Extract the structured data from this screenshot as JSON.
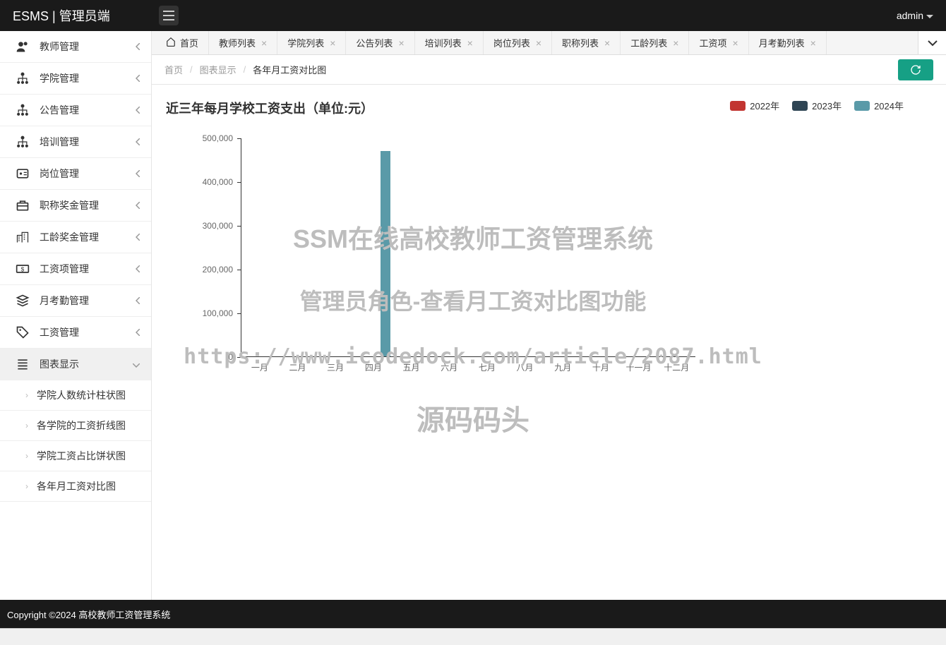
{
  "header": {
    "brand": "ESMS | 管理员端",
    "user": "admin"
  },
  "sidebar": {
    "items": [
      {
        "label": "教师管理",
        "icon": "users"
      },
      {
        "label": "学院管理",
        "icon": "org"
      },
      {
        "label": "公告管理",
        "icon": "org"
      },
      {
        "label": "培训管理",
        "icon": "org"
      },
      {
        "label": "岗位管理",
        "icon": "badge"
      },
      {
        "label": "职称奖金管理",
        "icon": "briefcase"
      },
      {
        "label": "工龄奖金管理",
        "icon": "building"
      },
      {
        "label": "工资项管理",
        "icon": "money"
      },
      {
        "label": "月考勤管理",
        "icon": "stack"
      },
      {
        "label": "工资管理",
        "icon": "tag"
      },
      {
        "label": "图表显示",
        "icon": "list",
        "expanded": true
      }
    ],
    "subitems": [
      {
        "label": "学院人数统计柱状图"
      },
      {
        "label": "各学院的工资折线图"
      },
      {
        "label": "学院工资占比饼状图"
      },
      {
        "label": "各年月工资对比图"
      }
    ]
  },
  "tabs": {
    "home": "首页",
    "items": [
      {
        "label": "教师列表"
      },
      {
        "label": "学院列表"
      },
      {
        "label": "公告列表"
      },
      {
        "label": "培训列表"
      },
      {
        "label": "岗位列表"
      },
      {
        "label": "职称列表"
      },
      {
        "label": "工龄列表"
      },
      {
        "label": "工资项"
      },
      {
        "label": "月考勤列表"
      }
    ]
  },
  "breadcrumb": {
    "items": [
      "首页",
      "图表显示",
      "各年月工资对比图"
    ]
  },
  "chart": {
    "title": "近三年每月学校工资支出（单位:元）",
    "legend": [
      {
        "label": "2022年",
        "color": "#c23531"
      },
      {
        "label": "2023年",
        "color": "#2f4554"
      },
      {
        "label": "2024年",
        "color": "#5a9aa8"
      }
    ]
  },
  "chart_data": {
    "type": "bar",
    "title": "近三年每月学校工资支出（单位:元）",
    "xlabel": "",
    "ylabel": "",
    "ylim": [
      0,
      500000
    ],
    "y_ticks": [
      0,
      100000,
      200000,
      300000,
      400000,
      500000
    ],
    "categories": [
      "一月",
      "二月",
      "三月",
      "四月",
      "五月",
      "六月",
      "七月",
      "八月",
      "九月",
      "十月",
      "十一月",
      "十二月"
    ],
    "series": [
      {
        "name": "2022年",
        "color": "#c23531",
        "values": [
          0,
          0,
          0,
          0,
          0,
          0,
          0,
          0,
          0,
          0,
          0,
          0
        ]
      },
      {
        "name": "2023年",
        "color": "#2f4554",
        "values": [
          0,
          0,
          0,
          0,
          0,
          0,
          0,
          0,
          0,
          0,
          0,
          0
        ]
      },
      {
        "name": "2024年",
        "color": "#5a9aa8",
        "values": [
          0,
          0,
          0,
          470000,
          0,
          0,
          0,
          0,
          0,
          0,
          0,
          0
        ]
      }
    ]
  },
  "watermark": {
    "line1": "SSM在线高校教师工资管理系统",
    "line2": "管理员角色-查看月工资对比图功能",
    "line3": "https://www.icodedock.com/article/2087.html",
    "line4": "源码码头"
  },
  "footer": {
    "text": "Copyright ©2024 高校教师工资管理系统"
  }
}
